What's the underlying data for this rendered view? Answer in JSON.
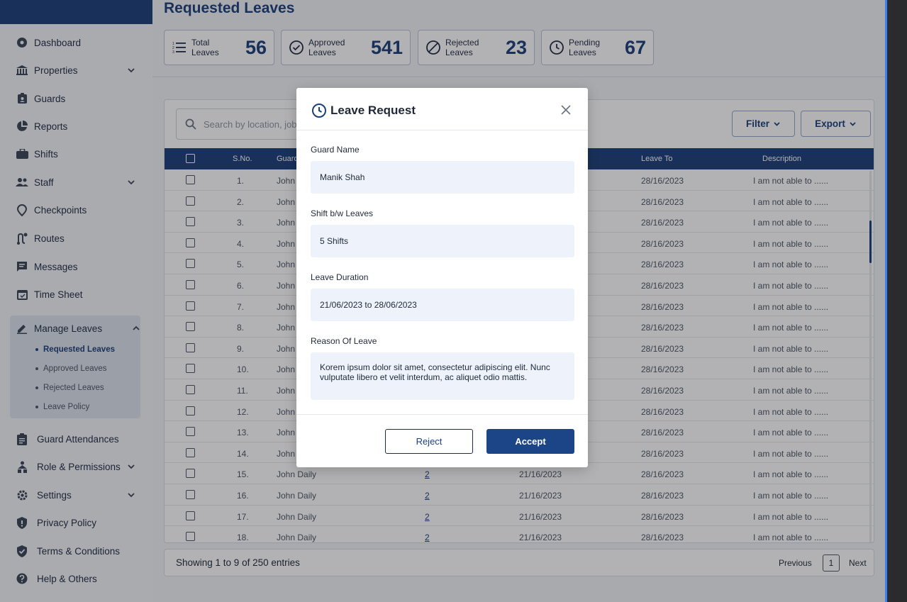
{
  "sidebar": {
    "items": [
      {
        "label": "Dashboard"
      },
      {
        "label": "Properties"
      },
      {
        "label": "Guards"
      },
      {
        "label": "Reports"
      },
      {
        "label": "Shifts"
      },
      {
        "label": "Staff"
      },
      {
        "label": "Checkpoints"
      },
      {
        "label": "Routes"
      },
      {
        "label": "Messages"
      },
      {
        "label": "Time Sheet"
      },
      {
        "label": "Manage Leaves"
      },
      {
        "label": "Guard Attendances"
      },
      {
        "label": "Role & Permissions"
      },
      {
        "label": "Settings"
      },
      {
        "label": "Privacy Policy"
      },
      {
        "label": "Terms & Conditions"
      },
      {
        "label": "Help & Others"
      }
    ],
    "leave_sub": [
      {
        "label": "Requested Leaves"
      },
      {
        "label": "Approved Leaves"
      },
      {
        "label": "Rejected Leaves"
      },
      {
        "label": "Leave Policy"
      }
    ]
  },
  "page": {
    "title": "Requested Leaves"
  },
  "stats": [
    {
      "line1": "Total",
      "line2": "Leaves",
      "value": "56"
    },
    {
      "line1": "Approved",
      "line2": "Leaves",
      "value": "541"
    },
    {
      "line1": "Rejected",
      "line2": "Leaves",
      "value": "23"
    },
    {
      "line1": "Pending",
      "line2": "Leaves",
      "value": "67"
    }
  ],
  "toolbar": {
    "search_placeholder": "Search by location, job",
    "filter_label": "Filter",
    "export_label": "Export"
  },
  "table": {
    "headers": {
      "sno": "S.No.",
      "guard": "Guard",
      "leave_to": "Leave To",
      "description": "Description"
    },
    "rows": [
      {
        "sno": "1.",
        "guard": "John",
        "shifts": "",
        "from": "",
        "to": "28/16/2023",
        "desc": "I am not able to ......"
      },
      {
        "sno": "2.",
        "guard": "John",
        "shifts": "",
        "from": "",
        "to": "28/16/2023",
        "desc": "I am not able to ......"
      },
      {
        "sno": "3.",
        "guard": "John",
        "shifts": "",
        "from": "",
        "to": "28/16/2023",
        "desc": "I am not able to ......"
      },
      {
        "sno": "4.",
        "guard": "John",
        "shifts": "",
        "from": "",
        "to": "28/16/2023",
        "desc": "I am not able to ......"
      },
      {
        "sno": "5.",
        "guard": "John",
        "shifts": "",
        "from": "",
        "to": "28/16/2023",
        "desc": "I am not able to ......"
      },
      {
        "sno": "6.",
        "guard": "John",
        "shifts": "",
        "from": "",
        "to": "28/16/2023",
        "desc": "I am not able to ......"
      },
      {
        "sno": "7.",
        "guard": "John",
        "shifts": "",
        "from": "",
        "to": "28/16/2023",
        "desc": "I am not able to ......"
      },
      {
        "sno": "8.",
        "guard": "John",
        "shifts": "",
        "from": "",
        "to": "28/16/2023",
        "desc": "I am not able to ......"
      },
      {
        "sno": "9.",
        "guard": "John",
        "shifts": "",
        "from": "",
        "to": "28/16/2023",
        "desc": "I am not able to ......"
      },
      {
        "sno": "10.",
        "guard": "John",
        "shifts": "",
        "from": "",
        "to": "28/16/2023",
        "desc": "I am not able to ......"
      },
      {
        "sno": "11.",
        "guard": "John",
        "shifts": "",
        "from": "",
        "to": "28/16/2023",
        "desc": "I am not able to ......"
      },
      {
        "sno": "12.",
        "guard": "John",
        "shifts": "",
        "from": "",
        "to": "28/16/2023",
        "desc": "I am not able to ......"
      },
      {
        "sno": "13.",
        "guard": "John",
        "shifts": "",
        "from": "",
        "to": "28/16/2023",
        "desc": "I am not able to ......"
      },
      {
        "sno": "14.",
        "guard": "John",
        "shifts": "",
        "from": "",
        "to": "28/16/2023",
        "desc": "I am not able to ......"
      },
      {
        "sno": "15.",
        "guard": "John Daily",
        "shifts": "2",
        "from": "21/16/2023",
        "to": "28/16/2023",
        "desc": "I am not able to ......"
      },
      {
        "sno": "16.",
        "guard": "John Daily",
        "shifts": "2",
        "from": "21/16/2023",
        "to": "28/16/2023",
        "desc": "I am not able to ......"
      },
      {
        "sno": "17.",
        "guard": "John Daily",
        "shifts": "2",
        "from": "21/16/2023",
        "to": "28/16/2023",
        "desc": "I am not able to ......"
      },
      {
        "sno": "18.",
        "guard": "John Daily",
        "shifts": "2",
        "from": "21/16/2023",
        "to": "28/16/2023",
        "desc": "I am not able to ......"
      }
    ]
  },
  "footer": {
    "entries": "Showing 1 to 9 of 250 entries",
    "previous": "Previous",
    "page": "1",
    "next": "Next"
  },
  "modal": {
    "title": "Leave Request",
    "guard_name_label": "Guard Name",
    "guard_name": "Manik Shah",
    "shift_label": "Shift b/w Leaves",
    "shift_value": "5 Shifts",
    "duration_label": "Leave Duration",
    "duration_value": "21/06/2023 to 28/06/2023",
    "reason_label": "Reason Of Leave",
    "reason_value": "Korem ipsum dolor sit amet, consectetur adipiscing elit. Nunc vulputate libero et velit interdum, ac aliquet odio mattis.",
    "reject_label": "Reject",
    "accept_label": "Accept"
  },
  "colors": {
    "brand": "#1c3f7a",
    "accent_button": "#1c4587",
    "field_bg": "#eef3fb"
  }
}
